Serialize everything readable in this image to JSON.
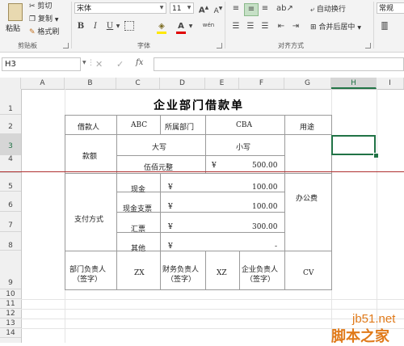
{
  "ribbon": {
    "clipboard": {
      "paste": "粘贴",
      "cut": "剪切",
      "copy": "复制",
      "format_painter": "格式刷",
      "label": "剪贴板"
    },
    "font": {
      "name": "宋体",
      "size": "11",
      "grow": "A",
      "shrink": "A",
      "bold": "B",
      "italic": "I",
      "underline": "U",
      "font_color_glyph": "A",
      "wen": "wén",
      "label": "字体"
    },
    "alignment": {
      "wrap": "自动换行",
      "merge": "合并后居中",
      "label": "对齐方式"
    },
    "number": {
      "format": "常规"
    }
  },
  "formula_bar": {
    "cell_ref": "H3",
    "fx": "fx",
    "cancel": "✕",
    "enter": "✓"
  },
  "columns": [
    "A",
    "B",
    "C",
    "D",
    "E",
    "F",
    "G",
    "H",
    "I"
  ],
  "rows": [
    "1",
    "2",
    "3",
    "4",
    "5",
    "6",
    "7",
    "8",
    "9",
    "10",
    "11",
    "12",
    "13",
    "14"
  ],
  "sheet": {
    "title": "企业部门借款单",
    "r2": {
      "b": "借款人",
      "c": "ABC",
      "d": "所属部门",
      "ef": "CBA",
      "g": "用途"
    },
    "r3": {
      "b": "款额",
      "cd": "大写",
      "ef": "小写"
    },
    "r4": {
      "cd": "伍佰元整",
      "e": "¥",
      "f": "500.00"
    },
    "pay_label": "支付方式",
    "pay_rows": [
      {
        "type": "现金",
        "sym": "¥",
        "amount": "100.00"
      },
      {
        "type": "现金支票",
        "sym": "¥",
        "amount": "100.00"
      },
      {
        "type": "汇票",
        "sym": "¥",
        "amount": "300.00"
      },
      {
        "type": "其他",
        "sym": "¥",
        "amount": "-"
      }
    ],
    "purpose": "办公费",
    "r9": {
      "b1": "部门负责人",
      "b2": "（签字）",
      "c": "ZX",
      "d1": "财务负责人",
      "d2": "（签字）",
      "e": "XZ",
      "f1": "企业负责人",
      "f2": "（签字）",
      "g": "CV"
    }
  },
  "watermark": {
    "line1": "jb51.net",
    "line2": "脚本之家"
  },
  "colors": {
    "accent": "#217346",
    "split_line": "#b03030",
    "title": "#000000"
  }
}
